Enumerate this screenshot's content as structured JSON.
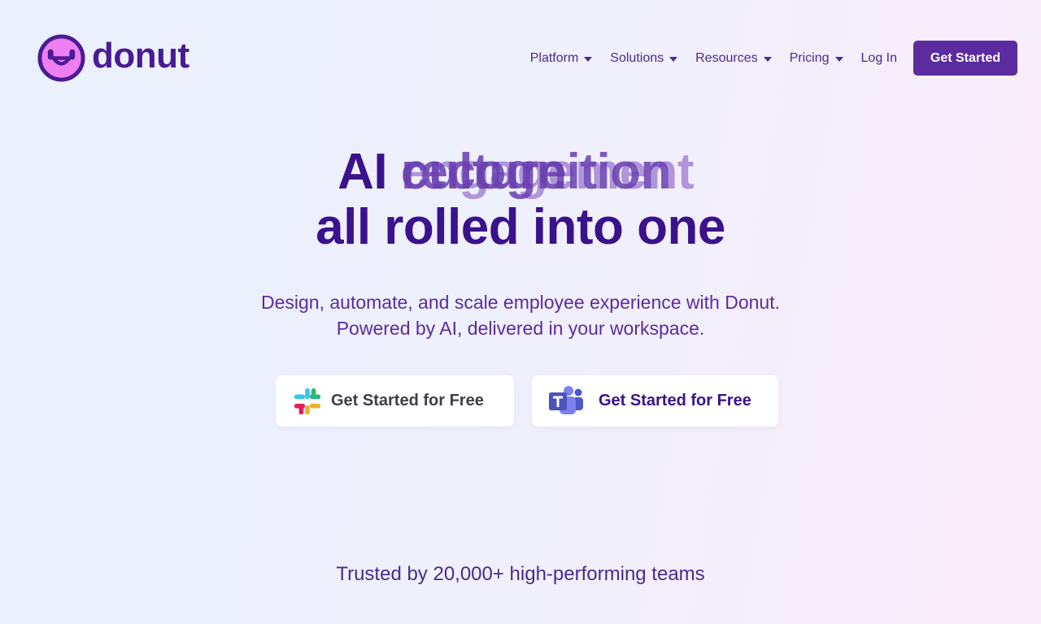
{
  "brand": {
    "name": "donut",
    "accent": "#5b2ba0",
    "logo_fill": "#ee7ff1"
  },
  "nav": {
    "items": [
      {
        "label": "Platform",
        "icon": "chevron-down-icon"
      },
      {
        "label": "Solutions",
        "icon": "chevron-down-icon"
      },
      {
        "label": "Resources",
        "icon": "chevron-down-icon"
      },
      {
        "label": "Pricing",
        "icon": "chevron-down-icon"
      }
    ],
    "login": "Log In",
    "cta": "Get Started"
  },
  "hero": {
    "title_prefix": "AI",
    "rotating_words": [
      "recognition",
      "engagement",
      "culture"
    ],
    "title_line2": "all rolled into one",
    "subtitle_line1": "Design, automate, and scale employee experience with Donut.",
    "subtitle_line2": "Powered by AI, delivered in your workspace."
  },
  "ctas": [
    {
      "label": "Get Started for Free",
      "icon": "slack-icon"
    },
    {
      "label": "Get Started for Free",
      "icon": "teams-icon"
    }
  ],
  "trusted": "Trusted by 20,000+ high-performing teams"
}
